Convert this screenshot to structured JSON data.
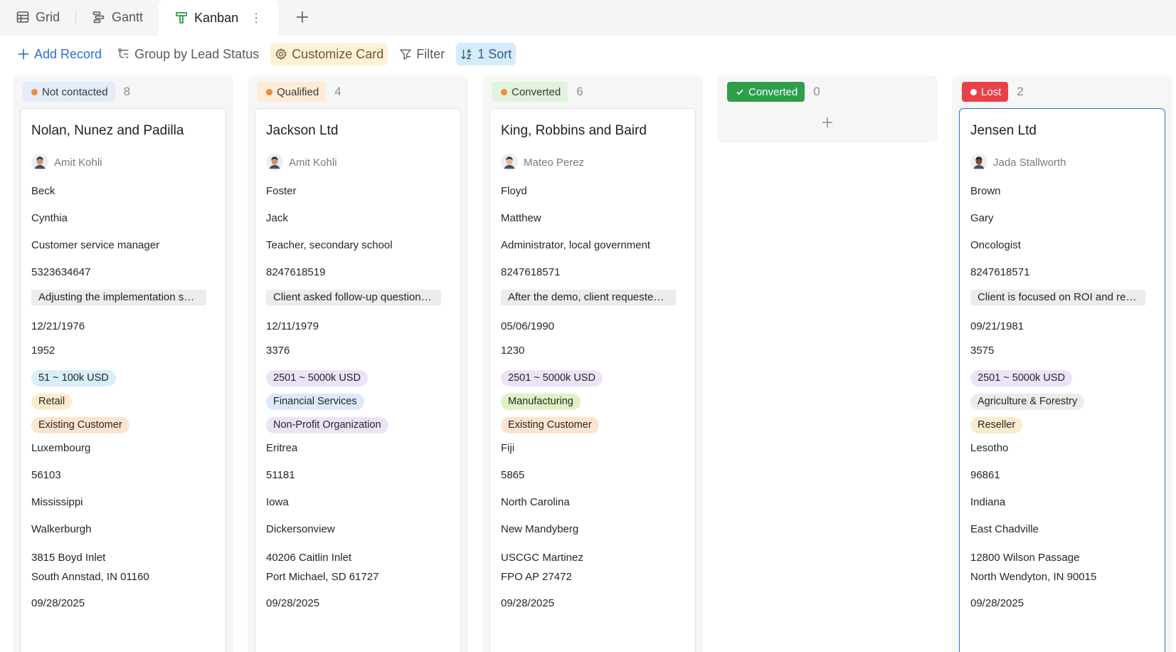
{
  "tabs": [
    {
      "label": "Grid"
    },
    {
      "label": "Gantt"
    },
    {
      "label": "Kanban"
    }
  ],
  "toolbar": {
    "add_record": "Add Record",
    "group_by": "Group by Lead Status",
    "customize": "Customize Card",
    "filter": "Filter",
    "sort": "1 Sort"
  },
  "columns": [
    {
      "status": "Not contacted",
      "count": "8",
      "pill_bg": "#e4ebfa",
      "dot": "#f08a3c",
      "text_color": "#3a3a3a",
      "card": {
        "title": "Nolan, Nunez and Padilla",
        "owner": "Amit Kohli",
        "last_name": "Beck",
        "first_name": "Cynthia",
        "job": "Customer service manager",
        "phone": "5323634647",
        "note": "Adjusting the implementation sch...",
        "birth": "12/21/1976",
        "employees": "1952",
        "revenue": "51 ~ 100k USD",
        "revenue_bg": "#d8eef9",
        "industry": "Retail",
        "industry_bg": "#fbeccd",
        "type": "Existing Customer",
        "type_bg": "#fce4cf",
        "country": "Luxembourg",
        "zip": "56103",
        "state": "Mississippi",
        "city": "Walkerburgh",
        "address1": "3815 Boyd Inlet",
        "address2": "South Annstad, IN 01160",
        "created": "09/28/2025"
      }
    },
    {
      "status": "Qualified",
      "count": "4",
      "pill_bg": "#fdebd8",
      "dot": "#f08a3c",
      "text_color": "#3a3a3a",
      "card": {
        "title": "Jackson Ltd",
        "owner": "Amit Kohli",
        "last_name": "Foster",
        "first_name": "Jack",
        "job": "Teacher, secondary school",
        "phone": "8247618519",
        "note": "Client asked follow-up questions, ...",
        "birth": "12/11/1979",
        "employees": "3376",
        "revenue": "2501 ~ 5000k USD",
        "revenue_bg": "#ece3f8",
        "industry": "Financial Services",
        "industry_bg": "#dde9fb",
        "type": "Non-Profit Organization",
        "type_bg": "#ece3f8",
        "country": "Eritrea",
        "zip": "51181",
        "state": "Iowa",
        "city": "Dickersonview",
        "address1": "40206 Caitlin Inlet",
        "address2": "Port Michael, SD 61727",
        "created": "09/28/2025"
      }
    },
    {
      "status": "Converted",
      "count": "6",
      "pill_bg": "#e0f3dc",
      "dot": "#f08a3c",
      "text_color": "#3a3a3a",
      "card": {
        "title": "King, Robbins and Baird",
        "owner": "Mateo Perez",
        "last_name": "Floyd",
        "first_name": "Matthew",
        "job": "Administrator, local government",
        "phone": "8247618571",
        "note": "After the demo, client requested ...",
        "birth": "05/06/1990",
        "employees": "1230",
        "revenue": "2501 ~ 5000k USD",
        "revenue_bg": "#ece3f8",
        "industry": "Manufacturing",
        "industry_bg": "#e0f2c4",
        "type": "Existing Customer",
        "type_bg": "#fce4cf",
        "country": "Fiji",
        "zip": "5865",
        "state": "North Carolina",
        "city": "New Mandyberg",
        "address1": "USCGC Martinez",
        "address2": "FPO AP 27472",
        "created": "09/28/2025"
      }
    },
    {
      "status": "Converted",
      "count": "0",
      "pill_bg": "#2e9e4a",
      "text_color": "#ffffff"
    },
    {
      "status": "Lost",
      "count": "2",
      "pill_bg": "#e8414a",
      "dot": "#ffffff",
      "text_color": "#ffffff",
      "card": {
        "title": "Jensen Ltd",
        "owner": "Jada Stallworth",
        "last_name": "Brown",
        "first_name": "Gary",
        "job": "Oncologist",
        "phone": "8247618571",
        "note": "Client is focused on ROI and requ...",
        "birth": "09/21/1981",
        "employees": "3575",
        "revenue": "2501 ~ 5000k USD",
        "revenue_bg": "#ece3f8",
        "industry": "Agriculture & Forestry",
        "industry_bg": "#ececec",
        "type": "Reseller",
        "type_bg": "#fbeccd",
        "country": "Lesotho",
        "zip": "96861",
        "state": "Indiana",
        "city": "East Chadville",
        "address1": "12800 Wilson Passage",
        "address2": "North Wendyton, IN 90015",
        "created": "09/28/2025"
      }
    }
  ],
  "colors": {
    "accent": "#2b6fd6",
    "kanban_icon": "#2e9e4a"
  },
  "icons": [
    "grid-icon",
    "gantt-icon",
    "kanban-icon",
    "more-icon",
    "plus-icon",
    "group-icon",
    "gear-icon",
    "filter-icon",
    "sort-icon",
    "check-icon"
  ]
}
